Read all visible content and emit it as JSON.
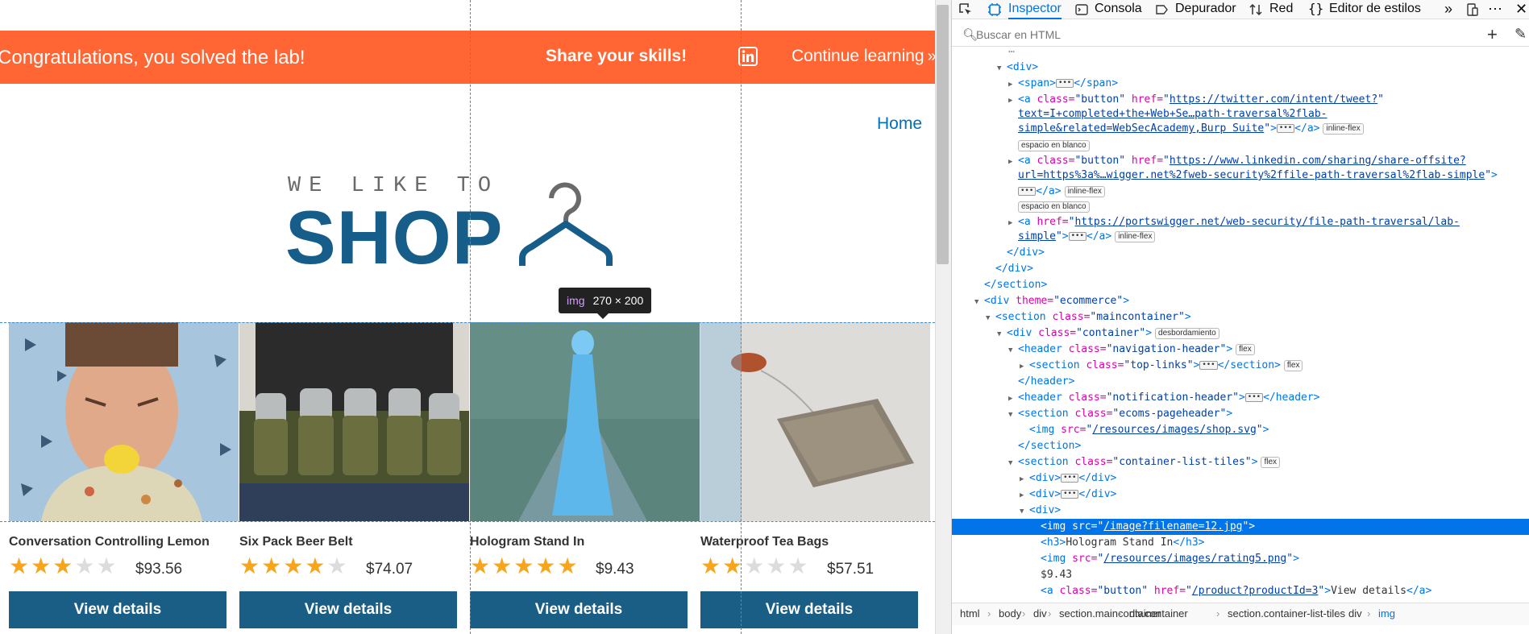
{
  "banner": {
    "message": "Congratulations, you solved the lab!",
    "share": "Share your skills!",
    "continue": "Continue learning",
    "chevron": "»"
  },
  "nav": {
    "home": "Home"
  },
  "logo": {
    "tagline": "WE LIKE TO",
    "word": "SHOP",
    "icon": "hanger-icon"
  },
  "tooltip": {
    "tag": "img",
    "size": "270 × 200"
  },
  "products": [
    {
      "name": "Conversation Controlling Lemon",
      "stars": 3,
      "price": "$93.56",
      "button": "View details",
      "image": "lemon-man"
    },
    {
      "name": "Six Pack Beer Belt",
      "stars": 4,
      "price": "$74.07",
      "button": "View details",
      "image": "beer-belt"
    },
    {
      "name": "Hologram Stand In",
      "stars": 5,
      "price": "$9.43",
      "button": "View details",
      "image": "hologram"
    },
    {
      "name": "Waterproof Tea Bags",
      "stars": 2,
      "price": "$57.51",
      "button": "View details",
      "image": "tea-bag"
    }
  ],
  "devtools": {
    "tabs": [
      "Inspector",
      "Consola",
      "Depurador",
      "Red",
      "Editor de estilos"
    ],
    "search_placeholder": "Buscar en HTML",
    "tree": {
      "r0": "<div>",
      "r1a": "<span>",
      "r1b": "</span>",
      "r2a": "<a",
      "r2attr": "class=",
      "r2val": "\"button\"",
      "r2href": "href=",
      "r2link1": "https://twitter.com/intent/tweet?",
      "r2link2": "text=I+completed+the+Web+Se…path-traversal%2flab-",
      "r2link3": "simple&related=WebSecAcademy,Burp Suite",
      "close_a": "</a>",
      "badge_flex": "inline-flex",
      "ws": "espacio en blanco",
      "r3link1": "https://www.linkedin.com/sharing/share-offsite?",
      "r3link2": "url=https%3a%…wigger.net%2fweb-security%2ffile-path-traversal%2flab-simple",
      "r4link1": "https://portswigger.net/web-security/file-path-traversal/lab-",
      "r4link2": "simple",
      "close_div": "</div>",
      "close_section": "</section>",
      "theme_attr": "theme=",
      "theme_val": "\"ecommerce\"",
      "maincontainer": "\"maincontainer\"",
      "container": "\"container\"",
      "badge_overflow": "desbordamiento",
      "nav_header": "\"navigation-header\"",
      "badge_flex2": "flex",
      "top_links": "\"top-links\"",
      "close_header": "</header>",
      "notif_header": "\"notification-header\"",
      "ecoms": "\"ecoms-pageheader\"",
      "img_src": "src=",
      "shop_svg": "/resources/images/shop.svg",
      "list_tiles": "\"container-list-tiles\"",
      "img12": "/image?filename=12.jpg",
      "h3_text": "Hologram Stand In",
      "rating5": "/resources/images/rating5.png",
      "price": "$9.43",
      "product3": "/product?productId=3",
      "view_details": "View details"
    },
    "breadcrumb": [
      "html",
      "body",
      "div",
      "section.maincontainer",
      "div.container",
      "section.container-list-tiles",
      "div",
      "img"
    ]
  }
}
